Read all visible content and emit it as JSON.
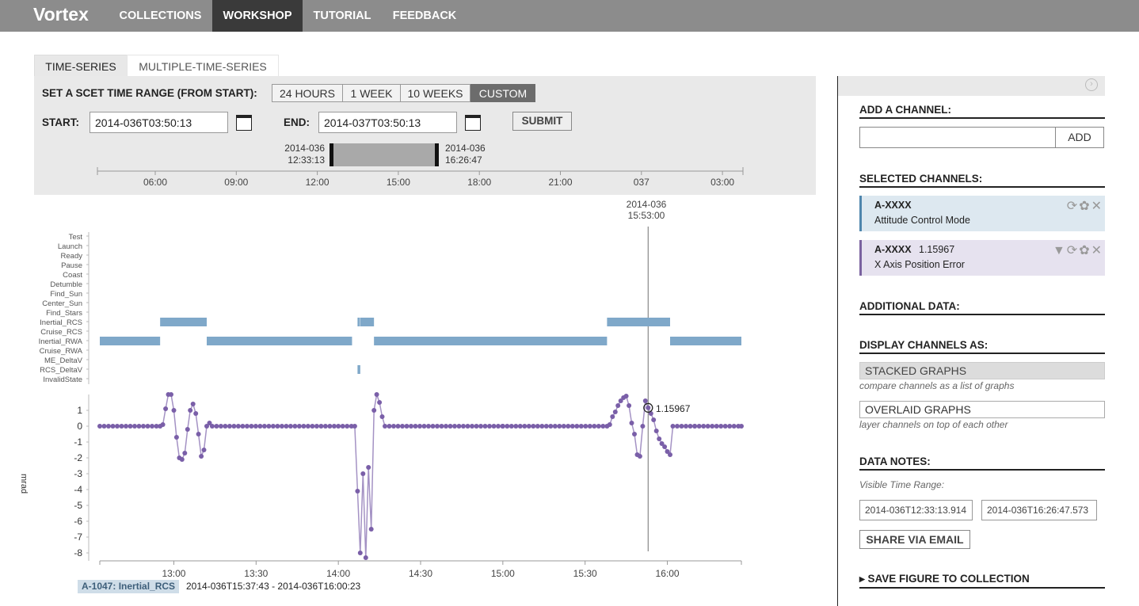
{
  "nav": {
    "logo": "Vortex",
    "items": [
      {
        "label": "COLLECTIONS",
        "active": false
      },
      {
        "label": "WORKSHOP",
        "active": true
      },
      {
        "label": "TUTORIAL",
        "active": false
      },
      {
        "label": "FEEDBACK",
        "active": false
      }
    ]
  },
  "tabs": [
    {
      "label": "TIME-SERIES",
      "active": true
    },
    {
      "label": "MULTIPLE-TIME-SERIES",
      "active": false
    }
  ],
  "range": {
    "label": "SET A SCET TIME RANGE (FROM START):",
    "options": [
      "24 HOURS",
      "1 WEEK",
      "10 WEEKS",
      "CUSTOM"
    ],
    "selected": "CUSTOM",
    "start_label": "START:",
    "start_value": "2014-036T03:50:13",
    "end_label": "END:",
    "end_value": "2014-037T03:50:13",
    "submit_label": "SUBMIT",
    "brush_left_date": "2014-036",
    "brush_left_time": "12:33:13",
    "brush_right_date": "2014-036",
    "brush_right_time": "16:26:47",
    "overview_ticks": [
      "06:00",
      "09:00",
      "12:00",
      "15:00",
      "18:00",
      "21:00",
      "037",
      "03:00"
    ]
  },
  "cursor": {
    "date": "2014-036",
    "time": "15:53:00",
    "value_label": "1.15967"
  },
  "state_chart": {
    "states": [
      "Test",
      "Launch",
      "Ready",
      "Pause",
      "Coast",
      "Detumble",
      "Find_Sun",
      "Center_Sun",
      "Find_Stars",
      "Inertial_RCS",
      "Cruise_RCS",
      "Inertial_RWA",
      "Cruise_RWA",
      "ME_DeltaV",
      "RCS_DeltaV",
      "InvalidState"
    ],
    "segments": [
      {
        "state": "Inertial_RWA",
        "start": "12:33",
        "end": "12:55"
      },
      {
        "state": "Inertial_RCS",
        "start": "12:55",
        "end": "13:12"
      },
      {
        "state": "Inertial_RWA",
        "start": "13:12",
        "end": "14:05"
      },
      {
        "state": "Inertial_RCS",
        "start": "14:07",
        "end": "14:07"
      },
      {
        "state": "RCS_DeltaV",
        "start": "14:07",
        "end": "14:08"
      },
      {
        "state": "Inertial_RCS",
        "start": "14:08",
        "end": "14:13"
      },
      {
        "state": "Inertial_RWA",
        "start": "14:13",
        "end": "15:38"
      },
      {
        "state": "Inertial_RCS",
        "start": "15:38",
        "end": "16:01"
      },
      {
        "state": "Inertial_RWA",
        "start": "16:01",
        "end": "16:27"
      }
    ],
    "color": "#7fa8c9"
  },
  "chart_data": {
    "type": "line",
    "ylabel": "mrad",
    "ylim": [
      -8.5,
      2
    ],
    "yticks": [
      1,
      0,
      -1,
      -2,
      -3,
      -4,
      -5,
      -6,
      -7,
      -8
    ],
    "xticks": [
      "13:00",
      "13:30",
      "14:00",
      "14:30",
      "15:00",
      "15:30",
      "16:00"
    ],
    "xlim": [
      "12:33",
      "16:27"
    ],
    "series": [
      {
        "color": "#7a5fa8",
        "points": [
          [
            "12:33",
            0
          ],
          [
            "12:55",
            0
          ],
          [
            "12:56",
            0.1
          ],
          [
            "12:57",
            1.1
          ],
          [
            "12:58",
            2.0
          ],
          [
            "12:59",
            2.0
          ],
          [
            "13:00",
            1.0
          ],
          [
            "13:01",
            -0.7
          ],
          [
            "13:02",
            -2.0
          ],
          [
            "13:03",
            -2.1
          ],
          [
            "13:04",
            -1.7
          ],
          [
            "13:05",
            -0.2
          ],
          [
            "13:06",
            1.0
          ],
          [
            "13:07",
            1.4
          ],
          [
            "13:08",
            0.8
          ],
          [
            "13:09",
            -0.5
          ],
          [
            "13:10",
            -1.9
          ],
          [
            "13:11",
            -1.5
          ],
          [
            "13:12",
            0
          ],
          [
            "13:13",
            0.2
          ],
          [
            "13:14",
            0
          ],
          [
            "14:00",
            0
          ],
          [
            "14:06",
            0
          ],
          [
            "14:07",
            -4.1
          ],
          [
            "14:08",
            -8.0
          ],
          [
            "14:09",
            -3.0
          ],
          [
            "14:10",
            -8.3
          ],
          [
            "14:11",
            -2.6
          ],
          [
            "14:12",
            -6.5
          ],
          [
            "14:13",
            1.0
          ],
          [
            "14:14",
            2.0
          ],
          [
            "14:15",
            1.5
          ],
          [
            "14:16",
            0.6
          ],
          [
            "14:17",
            0
          ],
          [
            "15:00",
            0
          ],
          [
            "15:38",
            0
          ],
          [
            "15:39",
            0.1
          ],
          [
            "15:40",
            0.6
          ],
          [
            "15:41",
            0.9
          ],
          [
            "15:42",
            1.3
          ],
          [
            "15:43",
            1.6
          ],
          [
            "15:44",
            1.8
          ],
          [
            "15:45",
            1.9
          ],
          [
            "15:46",
            1.3
          ],
          [
            "15:47",
            0.2
          ],
          [
            "15:48",
            -0.5
          ],
          [
            "15:49",
            -1.8
          ],
          [
            "15:50",
            -1.9
          ],
          [
            "15:51",
            0
          ],
          [
            "15:52",
            1.6
          ],
          [
            "15:53",
            1.16
          ],
          [
            "15:54",
            0.8
          ],
          [
            "15:55",
            0.4
          ],
          [
            "15:56",
            -0.3
          ],
          [
            "15:57",
            -0.8
          ],
          [
            "15:58",
            -1.1
          ],
          [
            "15:59",
            -1.3
          ],
          [
            "16:00",
            -1.6
          ],
          [
            "16:01",
            -1.8
          ],
          [
            "16:02",
            0
          ],
          [
            "16:10",
            0
          ],
          [
            "16:27",
            0
          ]
        ]
      }
    ]
  },
  "footer": {
    "badge": "A-1047: Inertial_RCS",
    "range": "2014-036T15:37:43 - 2014-036T16:00:23"
  },
  "sidebar": {
    "add_channel_heading": "ADD A CHANNEL:",
    "add_channel_placeholder": "",
    "add_button": "ADD",
    "selected_heading": "SELECTED CHANNELS:",
    "channels": [
      {
        "id": "A-XXXX",
        "value": "",
        "desc": "Attitude Control Mode",
        "color": "#4f86ad"
      },
      {
        "id": "A-XXXX",
        "value": "1.15967",
        "desc": "X Axis Position Error",
        "color": "#7a629f"
      }
    ],
    "additional_heading": "ADDITIONAL DATA:",
    "display_heading": "DISPLAY CHANNELS AS:",
    "stacked_label": "STACKED GRAPHS",
    "stacked_desc": "compare channels as a list of graphs",
    "overlaid_label": "OVERLAID GRAPHS",
    "overlaid_desc": "layer channels on top of each other",
    "notes_heading": "DATA NOTES:",
    "visible_range_label": "Visible Time Range:",
    "range_start": "2014-036T12:33:13.914",
    "range_end": "2014-036T16:26:47.573",
    "share_label": "SHARE VIA EMAIL",
    "save_label": "▸ SAVE FIGURE TO COLLECTION"
  }
}
